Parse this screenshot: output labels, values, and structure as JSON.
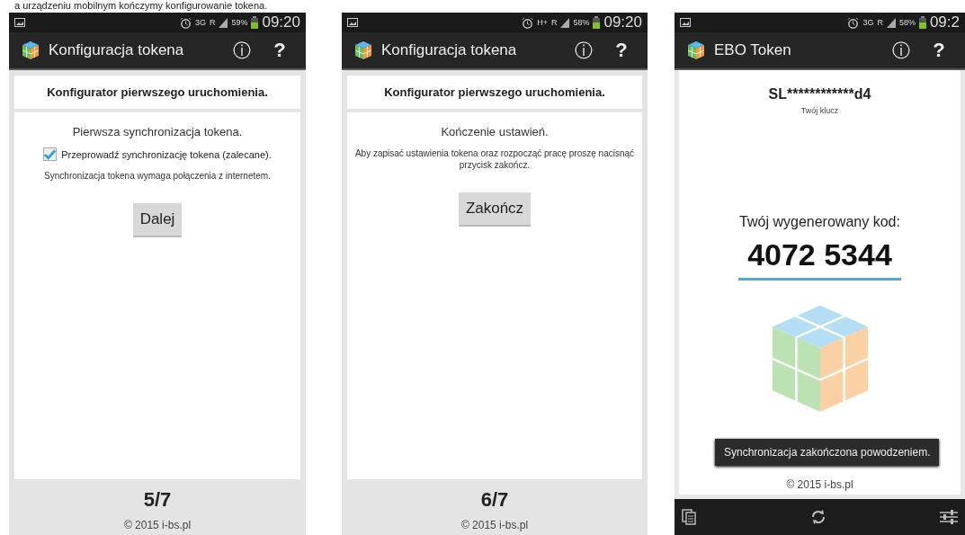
{
  "caption": "a urządzeniu mobilnym kończymy konfigurowanie tokena.",
  "screens": [
    {
      "kind": "wizard",
      "status": {
        "network": "3G",
        "roaming": "R",
        "battery": "59%",
        "time": "09:20"
      },
      "title": "Konfiguracja tokena",
      "info": "ⓘ",
      "help": "?",
      "header": "Konfigurator pierwszego uruchomienia.",
      "heading": "Pierwsza synchronizacja tokena.",
      "checkbox": {
        "label": "Przeprowadź synchronizację tokena (zalecane).",
        "checked": true
      },
      "note": "Synchronizacja tokena wymaga połączenia z internetem.",
      "button": "Dalej",
      "step": "5/7",
      "footer": "© 2015 i-bs.pl"
    },
    {
      "kind": "wizard",
      "status": {
        "network": "H+",
        "roaming": "R",
        "battery": "58%",
        "time": "09:20"
      },
      "title": "Konfiguracja tokena",
      "info": "ⓘ",
      "help": "?",
      "header": "Konfigurator pierwszego uruchomienia.",
      "heading": "Kończenie ustawień.",
      "note": "Aby zapisać ustawienia tokena oraz rozpocząć pracę proszę nacisnąć przycisk zakończ.",
      "button": "Zakończ",
      "step": "6/7",
      "footer": "© 2015 i-bs.pl"
    },
    {
      "kind": "token",
      "status": {
        "network": "3G",
        "roaming": "R",
        "battery": "58%",
        "time": "09:2"
      },
      "title": "EBO Token",
      "info": "ⓘ",
      "help": "?",
      "key": "SL************d4",
      "key_label": "Twój klucz",
      "code_label": "Twój wygenerowany kod:",
      "code": "4072 5344",
      "toast": "Synchronizacja zakończona powodzeniem.",
      "footer": "© 2015 i-bs.pl"
    }
  ]
}
